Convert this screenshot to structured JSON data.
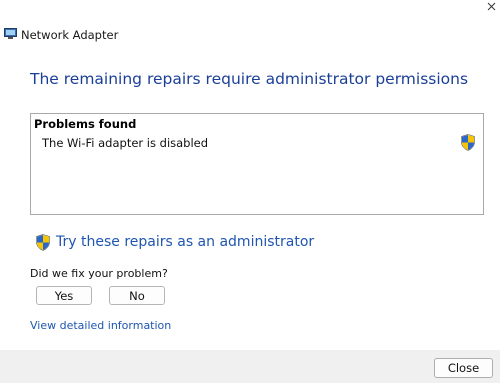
{
  "window": {
    "title": "Network Adapter",
    "app_icon": "network-adapter-icon",
    "close_icon": "close-icon"
  },
  "heading": "The remaining repairs require administrator permissions",
  "problems": {
    "title": "Problems found",
    "items": [
      {
        "text": "The Wi-Fi adapter is disabled",
        "icon": "uac-shield-icon"
      }
    ]
  },
  "admin_repair": {
    "label": "Try these repairs as an administrator",
    "icon": "uac-shield-icon"
  },
  "feedback": {
    "question": "Did we fix your problem?",
    "yes_label": "Yes",
    "no_label": "No"
  },
  "details_link": "View detailed information",
  "footer": {
    "close_label": "Close"
  },
  "colors": {
    "heading": "#1b3f99",
    "link": "#1e56b0",
    "footer_bg": "#f0f0f0",
    "border": "#a9a9a9"
  }
}
